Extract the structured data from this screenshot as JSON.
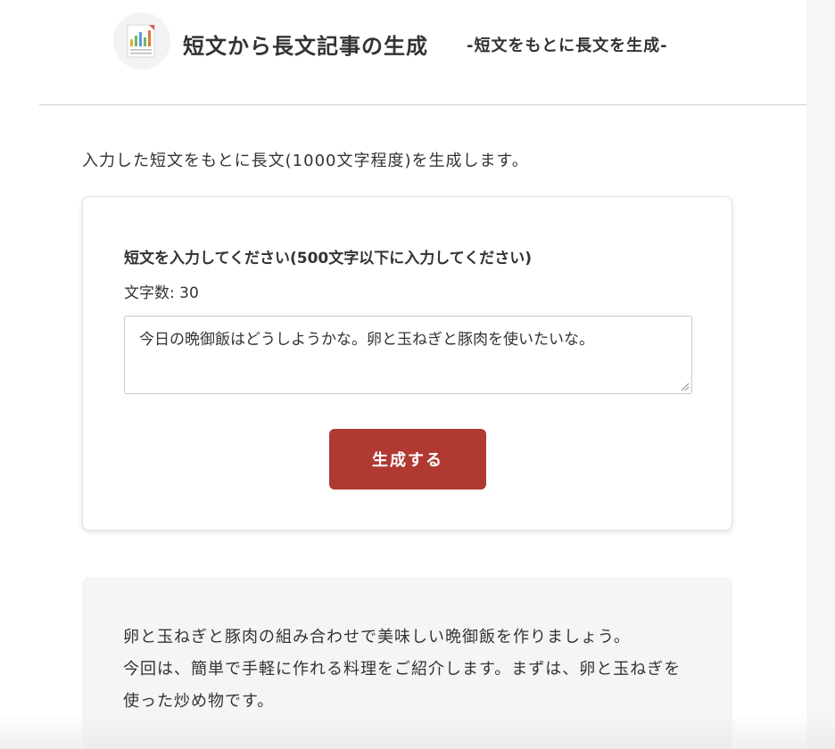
{
  "header": {
    "title": "短文から長文記事の生成",
    "subtitle": "-短文をもとに長文を生成-",
    "logo_icon": "document-chart-icon"
  },
  "intro": "入力した短文をもとに長文(1000文字程度)を生成します。",
  "form": {
    "label": "短文を入力してください(500文字以下に入力してください)",
    "char_count": "文字数: 30",
    "input_value": "今日の晩御飯はどうしようかな。卵と玉ねぎと豚肉を使いたいな。",
    "button_label": "生成する"
  },
  "output": {
    "paragraphs": [
      "卵と玉ねぎと豚肉の組み合わせで美味しい晩御飯を作りましょう。",
      "今回は、簡単で手軽に作れる料理をご紹介します。まずは、卵と玉ねぎを使った炒め物です。"
    ]
  },
  "colors": {
    "accent": "#b03a32",
    "output_bg": "#f4f5f7"
  }
}
